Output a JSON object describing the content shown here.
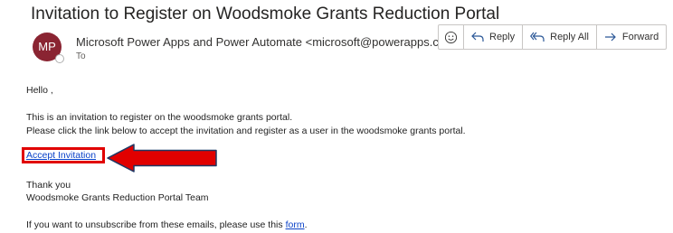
{
  "email": {
    "subject": "Invitation to Register on Woodsmoke Grants Reduction Portal",
    "avatar_initials": "MP",
    "sender": "Microsoft Power Apps and Power Automate <microsoft@powerapps.com>",
    "to_label": "To"
  },
  "toolbar": {
    "emoji_icon": "smiley-icon",
    "reply_label": "Reply",
    "reply_all_label": "Reply All",
    "forward_label": "Forward"
  },
  "body": {
    "greeting": "Hello          ,",
    "line1": "This is an invitation to register on the woodsmoke grants portal.",
    "line2": "Please click the link below to accept the invitation and register as a user in the woodsmoke grants portal.",
    "accept_link": "Accept Invitation",
    "thanks": "Thank you",
    "team": "Woodsmoke Grants Reduction Portal Team",
    "unsubscribe_prefix": "If you want to unsubscribe from these emails, please use this ",
    "unsubscribe_link": "form",
    "unsubscribe_suffix": "."
  },
  "colors": {
    "avatar": "#8a2432",
    "link": "#0b42c8",
    "highlight": "#e10000",
    "toolbar_icon": "#2b5797"
  }
}
